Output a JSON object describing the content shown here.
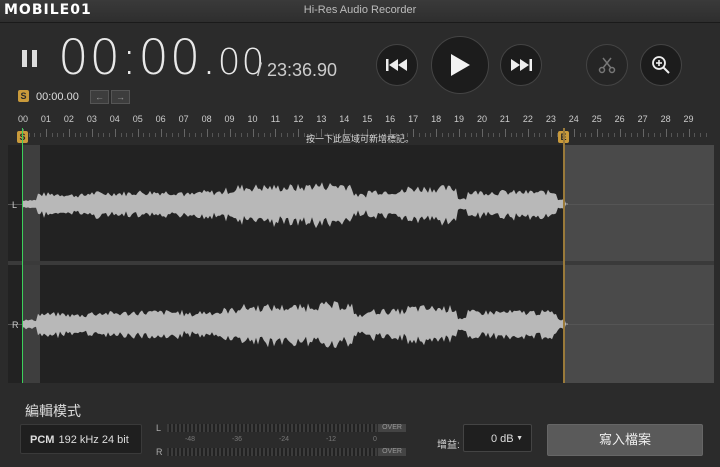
{
  "window": {
    "title": "Hi-Res Audio Recorder",
    "watermark": "MOBILE01"
  },
  "transport": {
    "timecode_main": "00:00.",
    "timecode_frac": "00",
    "total_duration": "/ 23:36.90",
    "start_marker_badge": "S",
    "start_marker_time": "00:00.00",
    "buttons": [
      "pause-icon",
      "skip-back-icon",
      "play-icon",
      "skip-forward-icon",
      "scissors-icon",
      "zoom-in-icon"
    ]
  },
  "timeline": {
    "labels": [
      "00",
      "01",
      "02",
      "03",
      "04",
      "05",
      "06",
      "07",
      "08",
      "09",
      "10",
      "11",
      "12",
      "13",
      "14",
      "15",
      "16",
      "17",
      "18",
      "19",
      "20",
      "21",
      "22",
      "23",
      "24",
      "25",
      "26",
      "27",
      "28",
      "29"
    ],
    "start_marker": "S",
    "end_marker": "E",
    "hint": "按一下此區域可新增標記。"
  },
  "channels": {
    "left": "L",
    "right": "R"
  },
  "editor": {
    "mode_title": "編輯模式",
    "format_codec": "PCM",
    "format_rate": "192 kHz",
    "format_bits": "24 bit"
  },
  "meter": {
    "left_label": "L",
    "right_label": "R",
    "over_label": "OVER",
    "scale": [
      "-48",
      "-36",
      "-24",
      "-12",
      "0"
    ]
  },
  "gain": {
    "label": "增益:",
    "value": "0 dB"
  },
  "write_button": "寫入檔案",
  "colors": {
    "playhead": "#3bd05a",
    "marker": "#c99a3b",
    "waveform": "#b8b8b8"
  }
}
